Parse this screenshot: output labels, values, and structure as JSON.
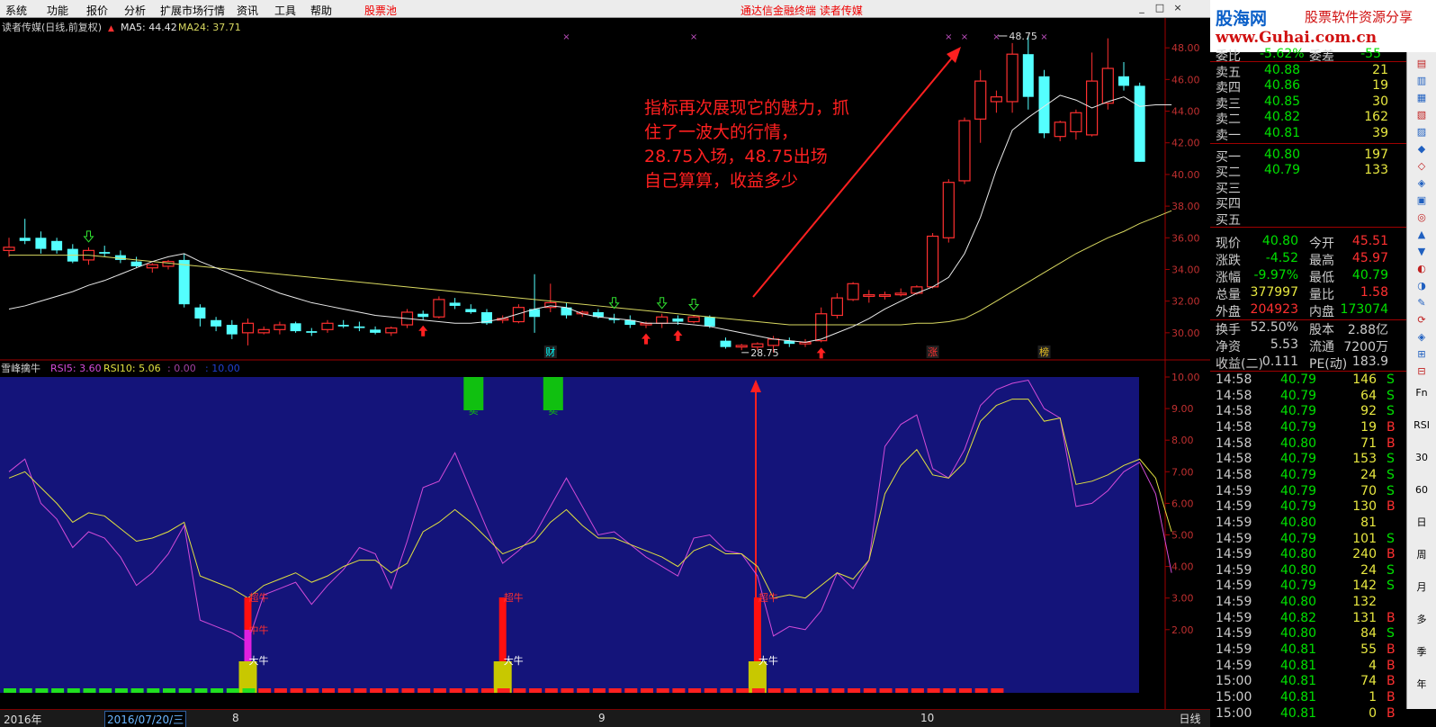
{
  "menu": {
    "items": [
      "系统",
      "功能",
      "报价",
      "分析",
      "扩展市场行情",
      "资讯",
      "工具",
      "帮助"
    ],
    "pool": "股票池",
    "center": "通达信金融终端 读者传媒",
    "controls": [
      "_",
      "□",
      "×"
    ]
  },
  "logo": {
    "name": "股海网",
    "slogan": "股票软件资源分享",
    "url": "www.Guhai.com.cn"
  },
  "main_legend": {
    "title": "读者传媒(日线,前复权)",
    "ma5": "MA5: 44.42",
    "ma24": "MA24: 37.71"
  },
  "sub_legend": {
    "title": "雪峰擒牛",
    "rsi5": "RSI5: 3.60",
    "rsi10": "RSI10: 5.06",
    "v3": ": 0.00",
    "v4": ": 10.00"
  },
  "annotation": {
    "lines": [
      "指标再次展现它的魅力，抓",
      "住了一波大的行情，",
      "28.75入场，48.75出场",
      "自己算算，收益多少"
    ]
  },
  "chart_data": [
    {
      "type": "candlestick",
      "title": "读者传媒(日线,前复权)",
      "ylim": [
        28.4,
        49.6
      ],
      "ticks": [
        "48.00",
        "46.00",
        "44.00",
        "42.00",
        "40.00",
        "38.00",
        "36.00",
        "34.00",
        "32.00",
        "30.00"
      ],
      "tick_values": [
        48,
        46,
        44,
        42,
        40,
        38,
        36,
        34,
        32,
        30
      ],
      "candles": [
        {
          "o": 35.2,
          "h": 36.0,
          "l": 34.8,
          "c": 35.4
        },
        {
          "o": 36.0,
          "h": 37.2,
          "l": 35.6,
          "c": 35.8
        },
        {
          "o": 36.0,
          "h": 36.4,
          "l": 35.0,
          "c": 35.3
        },
        {
          "o": 35.8,
          "h": 36.0,
          "l": 35.0,
          "c": 35.2
        },
        {
          "o": 35.3,
          "h": 35.6,
          "l": 34.4,
          "c": 34.5
        },
        {
          "o": 34.6,
          "h": 35.4,
          "l": 34.3,
          "c": 35.2
        },
        {
          "o": 35.1,
          "h": 35.5,
          "l": 34.8,
          "c": 35.0
        },
        {
          "o": 34.9,
          "h": 35.2,
          "l": 34.4,
          "c": 34.6
        },
        {
          "o": 34.5,
          "h": 34.8,
          "l": 34.1,
          "c": 34.2
        },
        {
          "o": 34.1,
          "h": 34.4,
          "l": 33.8,
          "c": 34.3
        },
        {
          "o": 34.2,
          "h": 34.6,
          "l": 34.0,
          "c": 34.5
        },
        {
          "o": 34.6,
          "h": 35.0,
          "l": 31.6,
          "c": 31.8
        },
        {
          "o": 31.6,
          "h": 31.8,
          "l": 30.4,
          "c": 30.9
        },
        {
          "o": 30.8,
          "h": 31.0,
          "l": 30.1,
          "c": 30.4
        },
        {
          "o": 30.5,
          "h": 30.8,
          "l": 29.6,
          "c": 29.9
        },
        {
          "o": 30.0,
          "h": 30.9,
          "l": 29.2,
          "c": 30.6
        },
        {
          "o": 30.0,
          "h": 30.4,
          "l": 29.9,
          "c": 30.2
        },
        {
          "o": 30.2,
          "h": 30.7,
          "l": 29.9,
          "c": 30.5
        },
        {
          "o": 30.6,
          "h": 30.7,
          "l": 30.0,
          "c": 30.1
        },
        {
          "o": 30.1,
          "h": 30.3,
          "l": 29.8,
          "c": 30.0
        },
        {
          "o": 30.2,
          "h": 30.8,
          "l": 30.0,
          "c": 30.6
        },
        {
          "o": 30.5,
          "h": 30.8,
          "l": 30.3,
          "c": 30.4
        },
        {
          "o": 30.4,
          "h": 30.7,
          "l": 30.1,
          "c": 30.3
        },
        {
          "o": 30.2,
          "h": 30.4,
          "l": 29.9,
          "c": 30.0
        },
        {
          "o": 30.0,
          "h": 30.4,
          "l": 29.8,
          "c": 30.3
        },
        {
          "o": 30.5,
          "h": 31.5,
          "l": 30.3,
          "c": 31.3
        },
        {
          "o": 31.2,
          "h": 31.4,
          "l": 30.8,
          "c": 31.0
        },
        {
          "o": 31.0,
          "h": 32.3,
          "l": 30.9,
          "c": 32.1
        },
        {
          "o": 31.9,
          "h": 32.2,
          "l": 31.5,
          "c": 31.7
        },
        {
          "o": 31.5,
          "h": 31.8,
          "l": 31.2,
          "c": 31.3
        },
        {
          "o": 31.3,
          "h": 31.5,
          "l": 30.5,
          "c": 30.6
        },
        {
          "o": 30.8,
          "h": 31.1,
          "l": 30.6,
          "c": 30.9
        },
        {
          "o": 30.7,
          "h": 31.8,
          "l": 30.6,
          "c": 31.6
        },
        {
          "o": 31.5,
          "h": 33.7,
          "l": 30.0,
          "c": 31.0
        },
        {
          "o": 31.6,
          "h": 33.1,
          "l": 31.3,
          "c": 31.9
        },
        {
          "o": 31.6,
          "h": 31.9,
          "l": 30.9,
          "c": 31.1
        },
        {
          "o": 31.2,
          "h": 31.4,
          "l": 31.0,
          "c": 31.3
        },
        {
          "o": 31.3,
          "h": 31.5,
          "l": 30.9,
          "c": 31.0
        },
        {
          "o": 30.9,
          "h": 31.2,
          "l": 30.6,
          "c": 30.8
        },
        {
          "o": 30.8,
          "h": 31.1,
          "l": 30.3,
          "c": 30.5
        },
        {
          "o": 30.5,
          "h": 30.7,
          "l": 30.3,
          "c": 30.6
        },
        {
          "o": 30.6,
          "h": 31.2,
          "l": 30.3,
          "c": 31.0
        },
        {
          "o": 30.9,
          "h": 31.1,
          "l": 30.5,
          "c": 30.7
        },
        {
          "o": 30.7,
          "h": 31.1,
          "l": 30.6,
          "c": 31.0
        },
        {
          "o": 31.0,
          "h": 31.1,
          "l": 30.3,
          "c": 30.4
        },
        {
          "o": 29.5,
          "h": 29.7,
          "l": 29.0,
          "c": 29.1
        },
        {
          "o": 29.1,
          "h": 29.3,
          "l": 28.9,
          "c": 29.2
        },
        {
          "o": 29.1,
          "h": 29.4,
          "l": 28.9,
          "c": 29.3
        },
        {
          "o": 29.2,
          "h": 29.8,
          "l": 28.75,
          "c": 29.6
        },
        {
          "o": 29.5,
          "h": 29.7,
          "l": 29.1,
          "c": 29.3
        },
        {
          "o": 29.3,
          "h": 29.6,
          "l": 29.1,
          "c": 29.4
        },
        {
          "o": 29.5,
          "h": 31.6,
          "l": 29.4,
          "c": 31.2
        },
        {
          "o": 31.1,
          "h": 32.5,
          "l": 30.9,
          "c": 32.2
        },
        {
          "o": 32.1,
          "h": 33.2,
          "l": 32.0,
          "c": 33.1
        },
        {
          "o": 32.3,
          "h": 32.7,
          "l": 31.9,
          "c": 32.4
        },
        {
          "o": 32.3,
          "h": 32.6,
          "l": 32.1,
          "c": 32.4
        },
        {
          "o": 32.4,
          "h": 32.8,
          "l": 32.3,
          "c": 32.5
        },
        {
          "o": 32.5,
          "h": 33.0,
          "l": 32.4,
          "c": 32.9
        },
        {
          "o": 32.9,
          "h": 36.3,
          "l": 32.8,
          "c": 36.1
        },
        {
          "o": 36.0,
          "h": 39.7,
          "l": 35.7,
          "c": 39.5
        },
        {
          "o": 39.6,
          "h": 43.6,
          "l": 39.4,
          "c": 43.4
        },
        {
          "o": 43.5,
          "h": 46.6,
          "l": 42.0,
          "c": 45.9
        },
        {
          "o": 44.6,
          "h": 45.3,
          "l": 43.9,
          "c": 44.9
        },
        {
          "o": 44.6,
          "h": 48.3,
          "l": 43.9,
          "c": 47.6
        },
        {
          "o": 47.6,
          "h": 48.75,
          "l": 44.1,
          "c": 44.9
        },
        {
          "o": 46.2,
          "h": 46.6,
          "l": 42.3,
          "c": 42.6
        },
        {
          "o": 42.4,
          "h": 43.4,
          "l": 42.1,
          "c": 43.3
        },
        {
          "o": 42.7,
          "h": 44.1,
          "l": 42.2,
          "c": 43.9
        },
        {
          "o": 42.5,
          "h": 47.7,
          "l": 42.4,
          "c": 45.9
        },
        {
          "o": 44.5,
          "h": 48.6,
          "l": 44.1,
          "c": 46.7
        },
        {
          "o": 46.2,
          "h": 47.1,
          "l": 45.3,
          "c": 45.6
        },
        {
          "o": 45.6,
          "h": 45.8,
          "l": 40.8,
          "c": 40.8
        }
      ],
      "ma5": [
        31.5,
        31.7,
        32.0,
        32.3,
        32.6,
        33.0,
        33.3,
        33.7,
        34.1,
        34.5,
        34.8,
        35.0,
        34.5,
        34.1,
        33.7,
        33.3,
        32.9,
        32.5,
        32.2,
        31.9,
        31.7,
        31.5,
        31.3,
        31.1,
        31.0,
        30.9,
        30.8,
        30.7,
        30.6,
        30.6,
        30.7,
        30.9,
        31.2,
        31.5,
        31.7,
        31.6,
        31.2,
        31.0,
        30.9,
        30.8,
        30.6,
        30.6,
        30.6,
        30.5,
        30.4,
        30.2,
        30.0,
        29.8,
        29.6,
        29.5,
        29.4,
        29.6,
        30.0,
        30.4,
        30.9,
        31.5,
        32.0,
        32.5,
        32.9,
        33.5,
        35.0,
        37.3,
        40.3,
        42.8,
        43.6,
        44.3,
        45.0,
        44.7,
        44.2,
        44.6,
        44.9,
        44.3,
        44.4,
        44.4
      ],
      "ma24": [
        34.9,
        34.9,
        34.9,
        34.9,
        34.9,
        34.9,
        34.8,
        34.7,
        34.6,
        34.5,
        34.4,
        34.3,
        34.2,
        34.1,
        34.0,
        33.9,
        33.8,
        33.7,
        33.6,
        33.5,
        33.4,
        33.3,
        33.2,
        33.1,
        33.0,
        32.9,
        32.8,
        32.7,
        32.6,
        32.5,
        32.4,
        32.3,
        32.2,
        32.1,
        32.0,
        31.9,
        31.8,
        31.7,
        31.6,
        31.5,
        31.4,
        31.3,
        31.2,
        31.1,
        31.0,
        30.9,
        30.8,
        30.7,
        30.6,
        30.5,
        30.5,
        30.5,
        30.5,
        30.5,
        30.5,
        30.5,
        30.5,
        30.6,
        30.6,
        30.7,
        30.9,
        31.4,
        32.0,
        32.6,
        33.2,
        33.8,
        34.4,
        35.0,
        35.5,
        36.0,
        36.4,
        36.9,
        37.3,
        37.71
      ],
      "low_marker": "28.75",
      "high_marker": "48.75",
      "event_labels": [
        "财",
        "涨",
        "榜"
      ],
      "up_arrows": [
        26,
        40,
        42,
        51
      ],
      "down_arrows": [
        5,
        38,
        41,
        43
      ]
    },
    {
      "type": "line",
      "title": "雪峰擒牛",
      "ylim": [
        0.0,
        10.0
      ],
      "ticks": [
        "10.00",
        "9.00",
        "8.00",
        "7.00",
        "6.00",
        "5.00",
        "4.00",
        "3.00",
        "2.00"
      ],
      "tick_values": [
        10,
        9,
        8,
        7,
        6,
        5,
        4,
        3,
        2
      ],
      "series": [
        {
          "name": "RSI5",
          "color": "#d24bd8",
          "values": [
            7.0,
            7.4,
            6.0,
            5.5,
            4.6,
            5.1,
            4.9,
            4.3,
            3.4,
            3.8,
            4.4,
            5.3,
            2.3,
            2.1,
            1.9,
            1.6,
            3.1,
            3.3,
            3.5,
            2.8,
            3.4,
            3.9,
            4.6,
            4.4,
            3.3,
            4.8,
            6.5,
            6.7,
            7.6,
            6.4,
            5.2,
            4.1,
            4.5,
            5.0,
            5.9,
            6.8,
            5.9,
            5.0,
            5.1,
            4.7,
            4.3,
            4.0,
            3.7,
            4.9,
            5.0,
            4.5,
            4.4,
            3.7,
            1.8,
            2.1,
            2.0,
            2.6,
            3.8,
            3.3,
            4.2,
            7.8,
            8.5,
            8.8,
            7.1,
            6.8,
            7.7,
            9.1,
            9.6,
            9.8,
            9.9,
            9.0,
            8.7,
            5.9,
            6.0,
            6.4,
            7.0,
            7.3,
            6.3,
            3.8
          ]
        },
        {
          "name": "RSI10",
          "color": "#e0e040",
          "values": [
            6.8,
            7.0,
            6.5,
            6.0,
            5.4,
            5.7,
            5.6,
            5.2,
            4.8,
            4.9,
            5.1,
            5.4,
            3.7,
            3.5,
            3.3,
            3.0,
            3.4,
            3.6,
            3.8,
            3.5,
            3.7,
            4.0,
            4.2,
            4.2,
            3.8,
            4.1,
            5.1,
            5.4,
            5.8,
            5.4,
            4.9,
            4.4,
            4.6,
            4.8,
            5.4,
            5.8,
            5.3,
            4.9,
            4.9,
            4.7,
            4.5,
            4.3,
            4.0,
            4.5,
            4.7,
            4.4,
            4.4,
            4.0,
            3.0,
            3.1,
            3.0,
            3.4,
            3.8,
            3.6,
            4.2,
            6.3,
            7.2,
            7.7,
            6.9,
            6.8,
            7.3,
            8.6,
            9.1,
            9.3,
            9.3,
            8.6,
            8.7,
            6.6,
            6.7,
            6.9,
            7.2,
            7.4,
            6.8,
            5.1
          ]
        }
      ],
      "sell_signals": [
        {
          "i": 29,
          "label": "卖"
        },
        {
          "i": 34,
          "label": "卖"
        }
      ],
      "buy_signals": [
        {
          "i": 15,
          "labels": [
            "超牛",
            "中牛",
            "大牛"
          ]
        },
        {
          "i": 31,
          "labels": [
            "超牛",
            "大牛"
          ]
        },
        {
          "i": 47,
          "labels": [
            "超牛",
            "大牛"
          ]
        }
      ],
      "trend_bars": {
        "green_until": 15,
        "red_from": 16,
        "red_until": 62
      }
    }
  ],
  "xaxis": {
    "year": "2016年",
    "date": "2016/07/20/三",
    "months": [
      "8",
      "9",
      "10"
    ],
    "dayline": "日线"
  },
  "quote_panel": {
    "header": [
      "委比",
      "-5.62%",
      "委差",
      "-55"
    ],
    "asks": [
      {
        "label": "卖五",
        "price": "40.88",
        "vol": "21"
      },
      {
        "label": "卖四",
        "price": "40.86",
        "vol": "19"
      },
      {
        "label": "卖三",
        "price": "40.85",
        "vol": "30"
      },
      {
        "label": "卖二",
        "price": "40.82",
        "vol": "162"
      },
      {
        "label": "卖一",
        "price": "40.81",
        "vol": "39"
      }
    ],
    "bids": [
      {
        "label": "买一",
        "price": "40.80",
        "vol": "197"
      },
      {
        "label": "买二",
        "price": "40.79",
        "vol": "133"
      },
      {
        "label": "买三",
        "price": "",
        "vol": ""
      },
      {
        "label": "买四",
        "price": "",
        "vol": ""
      },
      {
        "label": "买五",
        "price": "",
        "vol": ""
      }
    ],
    "stats": [
      {
        "k1": "现价",
        "v1": "40.80",
        "k2": "今开",
        "v2": "45.51",
        "c1": "#00e000",
        "c2": "#ff3030"
      },
      {
        "k1": "涨跌",
        "v1": "-4.52",
        "k2": "最高",
        "v2": "45.97",
        "c1": "#00e000",
        "c2": "#ff3030"
      },
      {
        "k1": "涨幅",
        "v1": "-9.97%",
        "k2": "最低",
        "v2": "40.79",
        "c1": "#00e000",
        "c2": "#00e000"
      },
      {
        "k1": "总量",
        "v1": "377997",
        "k2": "量比",
        "v2": "1.58",
        "c1": "#e8e840",
        "c2": "#ff3030"
      },
      {
        "k1": "外盘",
        "v1": "204923",
        "k2": "内盘",
        "v2": "173074",
        "c1": "#ff3030",
        "c2": "#00e000"
      }
    ],
    "stats2": [
      {
        "k1": "换手",
        "v1": "52.50%",
        "k2": "股本",
        "v2": "2.88亿"
      },
      {
        "k1": "净资",
        "v1": "5.53",
        "k2": "流通",
        "v2": "7200万"
      },
      {
        "k1": "收益(二)",
        "v1": "0.111",
        "k2": "PE(动)",
        "v2": "183.9"
      }
    ],
    "ticks": [
      {
        "t": "14:58",
        "p": "40.79",
        "v": "146",
        "s": "S"
      },
      {
        "t": "14:58",
        "p": "40.79",
        "v": "64",
        "s": "S"
      },
      {
        "t": "14:58",
        "p": "40.79",
        "v": "92",
        "s": "S"
      },
      {
        "t": "14:58",
        "p": "40.79",
        "v": "19",
        "s": "B"
      },
      {
        "t": "14:58",
        "p": "40.80",
        "v": "71",
        "s": "B"
      },
      {
        "t": "14:58",
        "p": "40.79",
        "v": "153",
        "s": "S"
      },
      {
        "t": "14:58",
        "p": "40.79",
        "v": "24",
        "s": "S"
      },
      {
        "t": "14:59",
        "p": "40.79",
        "v": "70",
        "s": "S"
      },
      {
        "t": "14:59",
        "p": "40.79",
        "v": "130",
        "s": "B"
      },
      {
        "t": "14:59",
        "p": "40.80",
        "v": "81",
        "s": ""
      },
      {
        "t": "14:59",
        "p": "40.79",
        "v": "101",
        "s": "S"
      },
      {
        "t": "14:59",
        "p": "40.80",
        "v": "240",
        "s": "B"
      },
      {
        "t": "14:59",
        "p": "40.80",
        "v": "24",
        "s": "S"
      },
      {
        "t": "14:59",
        "p": "40.79",
        "v": "142",
        "s": "S"
      },
      {
        "t": "14:59",
        "p": "40.80",
        "v": "132",
        "s": ""
      },
      {
        "t": "14:59",
        "p": "40.82",
        "v": "131",
        "s": "B"
      },
      {
        "t": "14:59",
        "p": "40.80",
        "v": "84",
        "s": "S"
      },
      {
        "t": "14:59",
        "p": "40.81",
        "v": "55",
        "s": "B"
      },
      {
        "t": "14:59",
        "p": "40.81",
        "v": "4",
        "s": "B"
      },
      {
        "t": "15:00",
        "p": "40.81",
        "v": "74",
        "s": "B"
      },
      {
        "t": "15:00",
        "p": "40.81",
        "v": "1",
        "s": "B"
      },
      {
        "t": "15:00",
        "p": "40.81",
        "v": "0",
        "s": "B"
      }
    ]
  },
  "toolbar": [
    "Fn",
    "RSI",
    "30",
    "60",
    "日",
    "周",
    "月",
    "多",
    "季",
    "年"
  ],
  "colors": {
    "up": "#ff3030",
    "down": "#54ffff",
    "ma5": "#e8e8e8",
    "ma24": "#d8d860",
    "rsi5": "#d24bd8",
    "rsi10": "#e0e040",
    "sub_bg": "#14147a",
    "annotation": "#ff2020"
  }
}
